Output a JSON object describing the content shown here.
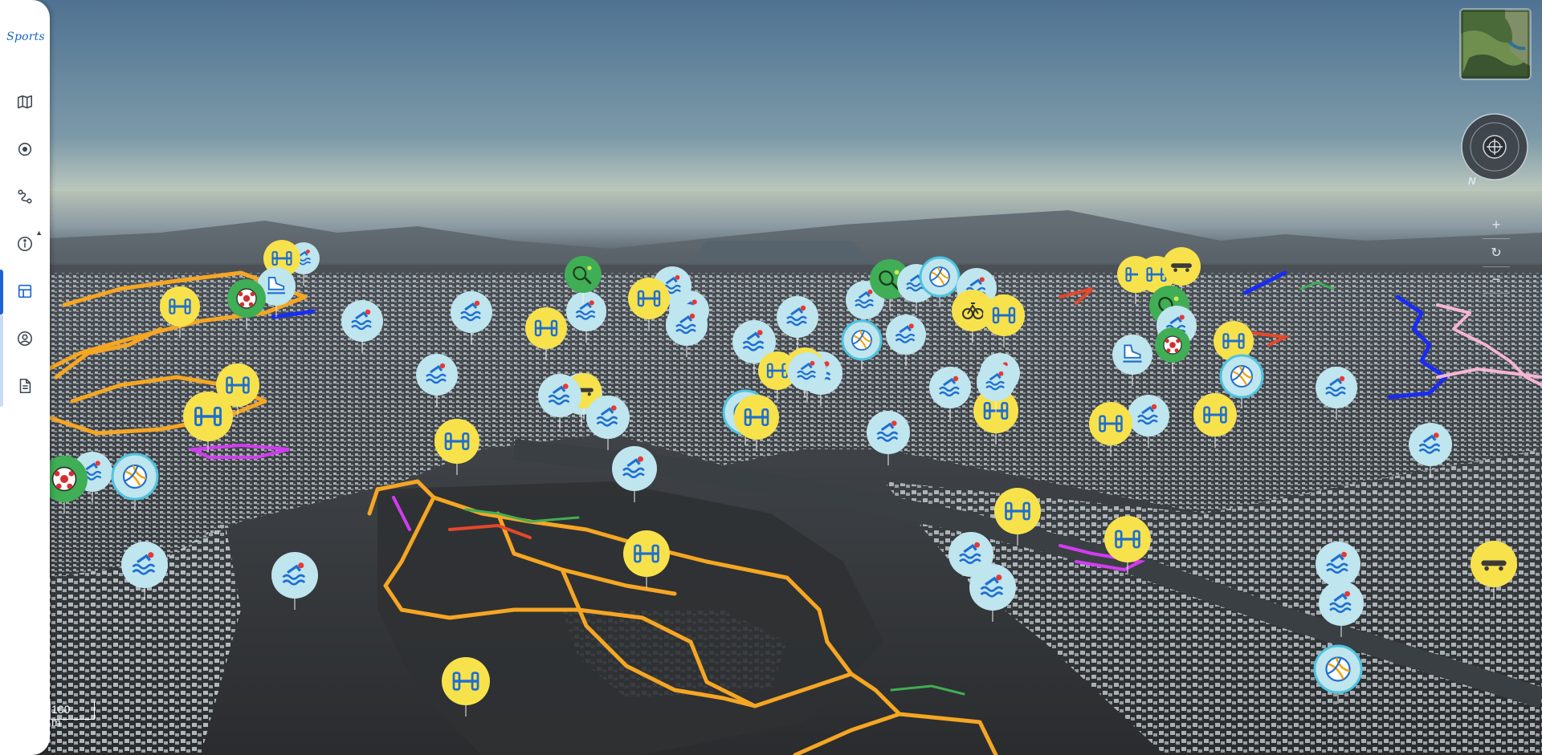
{
  "app": {
    "logo_text": "Sports"
  },
  "sidebar": {
    "items": [
      {
        "name": "sidebar-item-map",
        "icon": "map-icon"
      },
      {
        "name": "sidebar-item-target",
        "icon": "target-icon"
      },
      {
        "name": "sidebar-item-routes",
        "icon": "route-icon"
      },
      {
        "name": "sidebar-item-info",
        "icon": "info-icon"
      },
      {
        "name": "sidebar-item-dashboard",
        "icon": "dashboard-icon",
        "active": true
      },
      {
        "name": "sidebar-item-account",
        "icon": "account-icon"
      },
      {
        "name": "sidebar-item-document",
        "icon": "document-icon"
      }
    ]
  },
  "controls": {
    "zoom_in": "+",
    "zoom_reset": "↻",
    "zoom_out": "−",
    "compass_letter": "N"
  },
  "scale": {
    "label": "100 m"
  },
  "colors": {
    "sky": "#567895",
    "horizon": "#b8c7bf",
    "terrain": "#2d2f31",
    "building": "#c9d2d6",
    "route_orange": "#f5a623",
    "route_blue": "#1a2cf0",
    "route_pink": "#f4b5d3",
    "route_magenta": "#d23cf0",
    "route_red": "#e5482c",
    "pin_yellow": "#f7e24b",
    "pin_lightblue": "#bfe5ee",
    "pin_green": "#3fae55",
    "accent_blue": "#1e63d6"
  },
  "markers": [
    {
      "type": "swimming"
    },
    {
      "type": "fitness"
    },
    {
      "type": "skating"
    },
    {
      "type": "football"
    },
    {
      "type": "tennis"
    },
    {
      "type": "volleyball"
    },
    {
      "type": "cycling"
    },
    {
      "type": "skateboard"
    }
  ]
}
